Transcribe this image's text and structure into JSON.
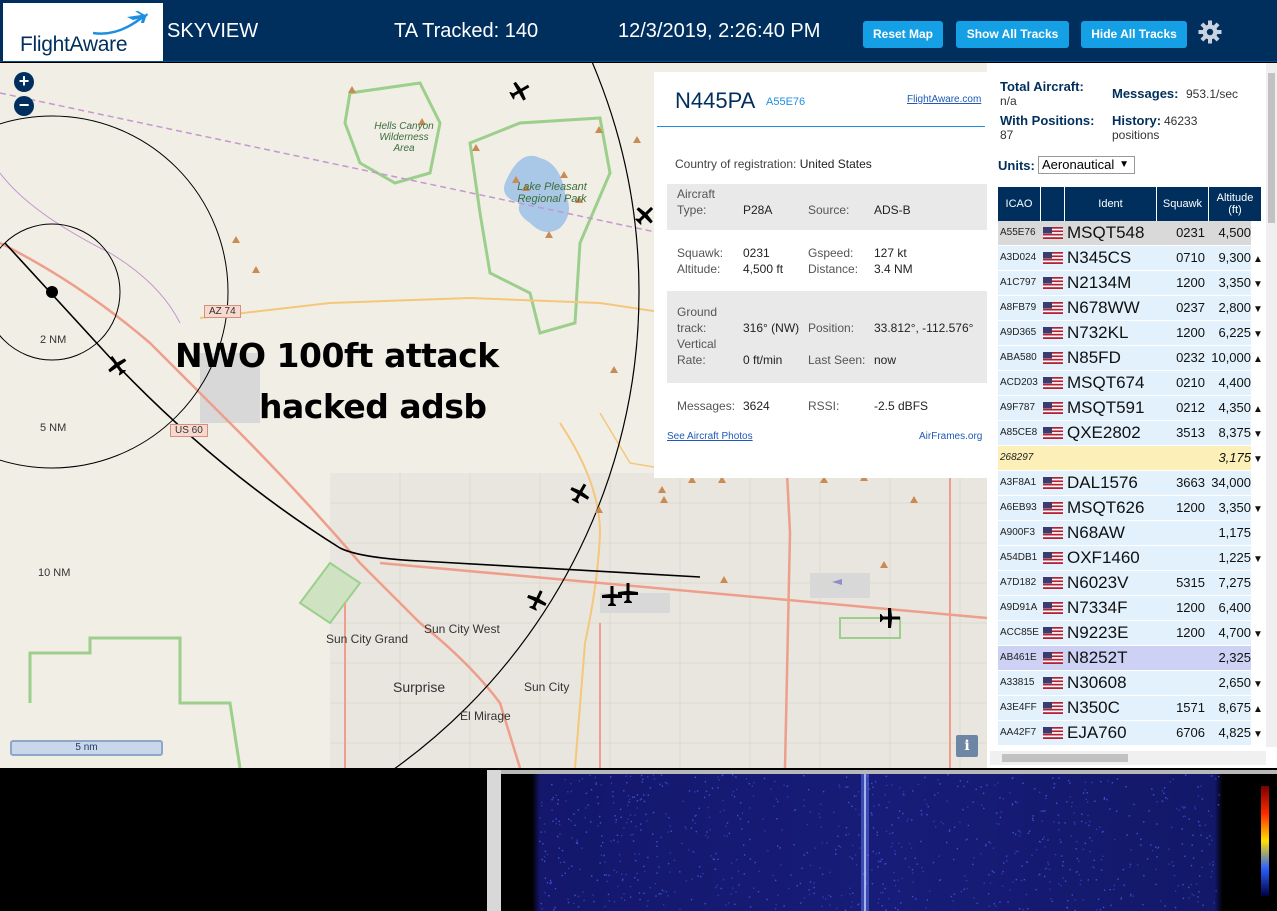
{
  "header": {
    "logo_text": "FlightAware",
    "title": "SKYVIEW",
    "tracked": "TA Tracked: 140",
    "datetime": "12/3/2019, 2:26:40 PM",
    "buttons": {
      "reset": "Reset Map",
      "show": "Show All Tracks",
      "hide": "Hide All Tracks"
    },
    "accent": "#15a0e6",
    "bg": "#002f5d"
  },
  "map": {
    "zoom_in": "+",
    "zoom_out": "−",
    "overlay_line1": "NWO 100ft attack",
    "overlay_line2": "hacked adsb",
    "scale": "5 nm",
    "info": "i",
    "rings": [
      "2 NM",
      "5 NM",
      "10 NM"
    ],
    "places": [
      "Hells Canyon Wilderness Area",
      "Lake Pleasant Regional Park",
      "Sun City Grand",
      "Sun City West",
      "Sun City",
      "Surprise",
      "El Mirage"
    ],
    "roads": [
      "AZ 74",
      "US 60"
    ]
  },
  "detail": {
    "registration": "N445PA",
    "hex": "A55E76",
    "fa_link": "FlightAware.com",
    "country_label": "Country of registration:",
    "country": "United States",
    "aircraft_type_label": "Aircraft Type:",
    "aircraft_type": "P28A",
    "source_label": "Source:",
    "source": "ADS-B",
    "squawk_label": "Squawk:",
    "squawk": "0231",
    "gspeed_label": "Gspeed:",
    "gspeed": "127 kt",
    "altitude_label": "Altitude:",
    "altitude": "4,500 ft",
    "distance_label": "Distance:",
    "distance": "3.4 NM",
    "track_label": "Ground track:",
    "track": "316° (NW)",
    "position_label": "Position:",
    "position": "33.812°, -112.576°",
    "vrate_label": "Vertical Rate:",
    "vrate": "0 ft/min",
    "lastseen_label": "Last Seen:",
    "lastseen": "now",
    "messages_label": "Messages:",
    "messages": "3624",
    "rssi_label": "RSSI:",
    "rssi": "-2.5 dBFS",
    "photos_link": "See Aircraft Photos",
    "airframes_link": "AirFrames.org"
  },
  "panel": {
    "total_label": "Total Aircraft:",
    "total": "n/a",
    "positions_label": "With Positions:",
    "positions": "87",
    "messages_label": "Messages:",
    "messages": "953.1/sec",
    "history_label": "History:",
    "history": "46233 positions",
    "units_label": "Units:",
    "units": "Aeronautical",
    "columns": [
      "ICAO",
      "Ident",
      "Squawk",
      "Altitude (ft)"
    ],
    "rows": [
      {
        "icao": "A55E76",
        "ident": "MSQT548",
        "squawk": "0231",
        "alt": "4,500",
        "trend": "",
        "hl": "sel"
      },
      {
        "icao": "A3D024",
        "ident": "N345CS",
        "squawk": "0710",
        "alt": "9,300",
        "trend": "▲",
        "hl": ""
      },
      {
        "icao": "A1C797",
        "ident": "N2134M",
        "squawk": "1200",
        "alt": "3,350",
        "trend": "▼",
        "hl": ""
      },
      {
        "icao": "A8FB79",
        "ident": "N678WW",
        "squawk": "0237",
        "alt": "2,800",
        "trend": "▼",
        "hl": ""
      },
      {
        "icao": "A9D365",
        "ident": "N732KL",
        "squawk": "1200",
        "alt": "6,225",
        "trend": "▼",
        "hl": ""
      },
      {
        "icao": "ABA580",
        "ident": "N85FD",
        "squawk": "0232",
        "alt": "10,000",
        "trend": "▲",
        "hl": ""
      },
      {
        "icao": "ACD203",
        "ident": "MSQT674",
        "squawk": "0210",
        "alt": "4,400",
        "trend": "",
        "hl": ""
      },
      {
        "icao": "A9F787",
        "ident": "MSQT591",
        "squawk": "0212",
        "alt": "4,350",
        "trend": "▲",
        "hl": ""
      },
      {
        "icao": "A85CE8",
        "ident": "QXE2802",
        "squawk": "3513",
        "alt": "8,375",
        "trend": "▼",
        "hl": ""
      },
      {
        "icao": "268297",
        "ident": "",
        "squawk": "",
        "alt": "3,175",
        "trend": "▼",
        "hl": "yellow"
      },
      {
        "icao": "A3F8A1",
        "ident": "DAL1576",
        "squawk": "3663",
        "alt": "34,000",
        "trend": "",
        "hl": ""
      },
      {
        "icao": "A6EB93",
        "ident": "MSQT626",
        "squawk": "1200",
        "alt": "3,350",
        "trend": "▼",
        "hl": ""
      },
      {
        "icao": "A900F3",
        "ident": "N68AW",
        "squawk": "",
        "alt": "1,175",
        "trend": "",
        "hl": ""
      },
      {
        "icao": "A54DB1",
        "ident": "OXF1460",
        "squawk": "",
        "alt": "1,225",
        "trend": "▼",
        "hl": ""
      },
      {
        "icao": "A7D182",
        "ident": "N6023V",
        "squawk": "5315",
        "alt": "7,275",
        "trend": "",
        "hl": ""
      },
      {
        "icao": "A9D91A",
        "ident": "N7334F",
        "squawk": "1200",
        "alt": "6,400",
        "trend": "",
        "hl": ""
      },
      {
        "icao": "ACC85E",
        "ident": "N9223E",
        "squawk": "1200",
        "alt": "4,700",
        "trend": "▼",
        "hl": ""
      },
      {
        "icao": "AB461E",
        "ident": "N8252T",
        "squawk": "",
        "alt": "2,325",
        "trend": "",
        "hl": "purple"
      },
      {
        "icao": "A33815",
        "ident": "N30608",
        "squawk": "",
        "alt": "2,650",
        "trend": "▼",
        "hl": ""
      },
      {
        "icao": "A3E4FF",
        "ident": "N350C",
        "squawk": "1571",
        "alt": "8,675",
        "trend": "▲",
        "hl": ""
      },
      {
        "icao": "AA42F7",
        "ident": "EJA760",
        "squawk": "6706",
        "alt": "4,825",
        "trend": "▼",
        "hl": ""
      }
    ]
  }
}
